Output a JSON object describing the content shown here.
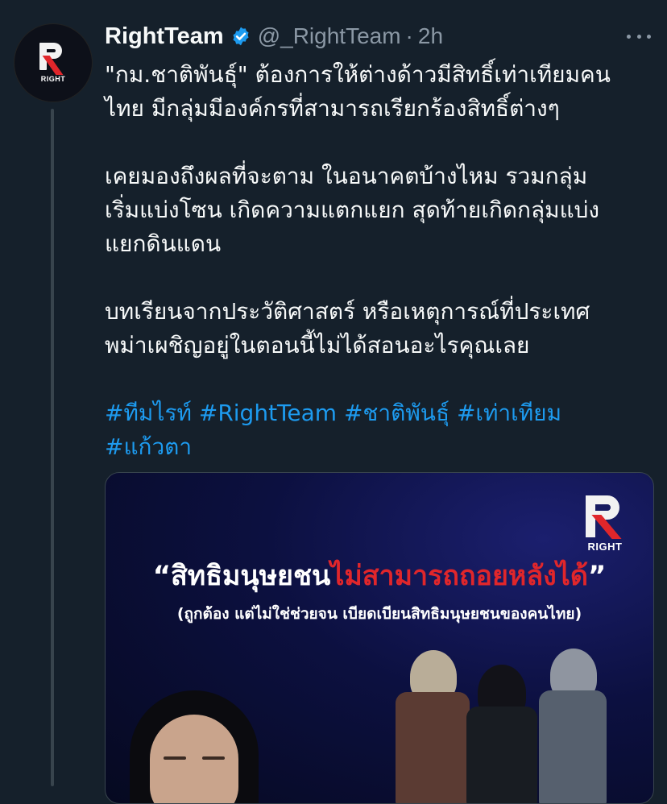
{
  "user": {
    "display_name": "RightTeam",
    "handle": "@_RightTeam",
    "separator": "·",
    "time": "2h",
    "avatar_label": "RIGHT",
    "verified_color": "#1d9bf0"
  },
  "tweet": {
    "paragraphs": [
      [
        "\"กม.ชาติพันธุ์\"  ต้องการให้ต่างด้าวมีสิทธิ์เท่าเทียมคน",
        "ไทย มีกลุ่มมีองค์กรที่สามารถเรียกร้องสิทธิ์ต่างๆ"
      ],
      [
        "เคยมองถึงผลที่จะตาม ในอนาคตบ้างไหม รวมกลุ่ม",
        "เริ่มแบ่งโซน เกิดความแตกแยก สุดท้ายเกิดกลุ่มแบ่ง",
        "แยกดินแดน"
      ],
      [
        "บทเรียนจากประวัติศาสตร์ หรือเหตุการณ์ที่ประเทศ",
        "พม่าเผชิญอยู่ในตอนนี้ไม่ได้สอนอะไรคุณเลย"
      ]
    ],
    "hashtags": [
      "#ทีมไรท์",
      "#RightTeam",
      "#ชาติพันธุ์",
      "#เท่าเทียม",
      "#แก้วตา"
    ],
    "link_color": "#1d9bf0"
  },
  "media": {
    "logo_label": "RIGHT",
    "headline_white": "“สิทธิมนุษยชน",
    "headline_red": "ไม่สามารถถอยหลังได้",
    "headline_close": "”",
    "subline": "(ถูกต้อง แต่ไม่ใช่ช่วยจน เบียดเบียนสิทธิมนุษยชนของคนไทย)",
    "accent_color": "#e0262b"
  }
}
